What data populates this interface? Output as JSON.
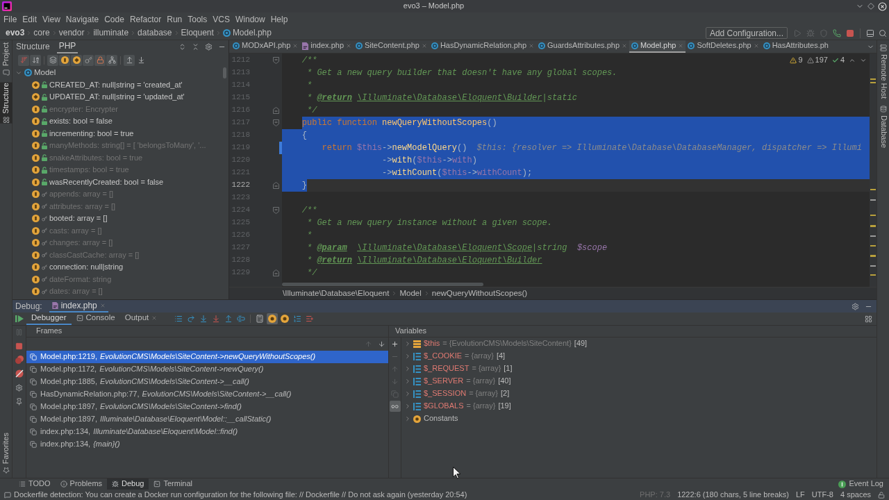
{
  "window": {
    "title": "evo3 – Model.php"
  },
  "menu": [
    "File",
    "Edit",
    "View",
    "Navigate",
    "Code",
    "Refactor",
    "Run",
    "Tools",
    "VCS",
    "Window",
    "Help"
  ],
  "breadcrumbs": [
    {
      "label": "evo3",
      "kind": "project"
    },
    {
      "label": "core",
      "kind": "folder"
    },
    {
      "label": "vendor",
      "kind": "folder"
    },
    {
      "label": "illuminate",
      "kind": "folder"
    },
    {
      "label": "database",
      "kind": "folder"
    },
    {
      "label": "Eloquent",
      "kind": "folder"
    },
    {
      "label": "Model.php",
      "kind": "file"
    }
  ],
  "run_toolbar": {
    "configuration": "Add Configuration...",
    "buttons": [
      {
        "kind": "run",
        "disabled": true
      },
      {
        "kind": "debug",
        "disabled": true
      },
      {
        "kind": "coverage",
        "disabled": true
      },
      {
        "kind": "listen",
        "disabled": false
      },
      {
        "kind": "stop",
        "disabled": false
      }
    ]
  },
  "left_strip": {
    "top": [
      {
        "label": "Project",
        "kind": "project",
        "selected": false
      },
      {
        "label": "Structure",
        "kind": "structure",
        "selected": true
      }
    ],
    "bottom": [
      {
        "label": "Favorites",
        "kind": "favorites",
        "selected": false
      }
    ]
  },
  "right_strip": [
    {
      "label": "Remote Host",
      "kind": "remote"
    },
    {
      "label": "Database",
      "kind": "database"
    }
  ],
  "structure": {
    "title": "Structure",
    "tabs": [
      {
        "label": "PHP",
        "selected": true
      }
    ],
    "toolbar": [
      {
        "kind": "sort_visibility",
        "on": true
      },
      {
        "kind": "sort_alpha",
        "on": true
      },
      {
        "kind": "inherited",
        "on": true
      },
      {
        "kind": "fields",
        "on": true
      },
      {
        "kind": "constants",
        "on": true
      },
      {
        "kind": "protected",
        "on": true
      },
      {
        "kind": "private",
        "on": true
      },
      {
        "kind": "tree",
        "on": true
      },
      {
        "kind": "scroll_to_source",
        "on": true
      },
      {
        "kind": "scroll_from_source",
        "on": false
      }
    ],
    "tree": {
      "label": "Model",
      "expanded": true,
      "children": [
        {
          "label": "CREATED_AT: null|string = 'created_at'",
          "kind": "constant",
          "protected": false,
          "greyed": false
        },
        {
          "label": "UPDATED_AT: null|string = 'updated_at'",
          "kind": "constant",
          "protected": false,
          "greyed": false
        },
        {
          "label": "encrypter: Encrypter",
          "kind": "field",
          "protected": false,
          "greyed": true
        },
        {
          "label": "exists: bool = false",
          "kind": "field",
          "protected": false,
          "greyed": false
        },
        {
          "label": "incrementing: bool = true",
          "kind": "field",
          "protected": false,
          "greyed": false
        },
        {
          "label": "manyMethods: string[] = [ 'belongsToMany', '...",
          "kind": "field",
          "protected": false,
          "greyed": true
        },
        {
          "label": "snakeAttributes: bool = true",
          "kind": "field",
          "protected": false,
          "greyed": true
        },
        {
          "label": "timestamps: bool = true",
          "kind": "field",
          "protected": false,
          "greyed": true
        },
        {
          "label": "wasRecentlyCreated: bool = false",
          "kind": "field",
          "protected": false,
          "greyed": false
        },
        {
          "label": "appends: array = []",
          "kind": "field",
          "protected": true,
          "greyed": true
        },
        {
          "label": "attributes: array = []",
          "kind": "field",
          "protected": true,
          "greyed": true
        },
        {
          "label": "booted: array = []",
          "kind": "field",
          "protected": true,
          "greyed": false
        },
        {
          "label": "casts: array = []",
          "kind": "field",
          "protected": true,
          "greyed": true
        },
        {
          "label": "changes: array = []",
          "kind": "field",
          "protected": true,
          "greyed": true
        },
        {
          "label": "classCastCache: array = []",
          "kind": "field",
          "protected": true,
          "greyed": true
        },
        {
          "label": "connection: null|string",
          "kind": "field",
          "protected": true,
          "greyed": false
        },
        {
          "label": "dateFormat: string",
          "kind": "field",
          "protected": true,
          "greyed": true
        },
        {
          "label": "dates: array = []",
          "kind": "field",
          "protected": true,
          "greyed": true
        }
      ]
    }
  },
  "editor": {
    "tabs": [
      {
        "label": "MODxAPI.php",
        "kind": "class",
        "selected": false,
        "close_button": true
      },
      {
        "label": "index.php",
        "kind": "script",
        "selected": false,
        "close_button": true
      },
      {
        "label": "SiteContent.php",
        "kind": "class",
        "selected": false,
        "close_button": true
      },
      {
        "label": "HasDynamicRelation.php",
        "kind": "class",
        "selected": false,
        "close_button": true
      },
      {
        "label": "GuardsAttributes.php",
        "kind": "class",
        "selected": false,
        "close_button": true
      },
      {
        "label": "Model.php",
        "kind": "class",
        "selected": true,
        "close_button": true
      },
      {
        "label": "SoftDeletes.php",
        "kind": "class",
        "selected": false,
        "close_button": true
      },
      {
        "label": "HasAttributes.ph",
        "kind": "class",
        "selected": false,
        "close_button": false
      }
    ],
    "inspections": {
      "warnings": "9",
      "weak_warnings": "197",
      "passed": "4"
    },
    "lines": [
      {
        "number": "1212",
        "fold": {
          "kind": "start"
        },
        "current": false,
        "tokens": [
          {
            "kind": "comment",
            "text": "    /**"
          }
        ]
      },
      {
        "number": "1213",
        "current": false,
        "tokens": [
          {
            "kind": "comment",
            "text": "     * Get a new query builder that doesn't have any global scopes."
          }
        ]
      },
      {
        "number": "1214",
        "current": false,
        "tokens": [
          {
            "kind": "comment",
            "text": "     *"
          }
        ]
      },
      {
        "number": "1215",
        "current": false,
        "tokens": [
          {
            "kind": "comment",
            "text": "     * "
          },
          {
            "kind": "doc_tag",
            "text": "@return"
          },
          {
            "kind": "doc_type",
            "text": " \\Illuminate\\Database\\Eloquent\\Builder"
          },
          {
            "kind": "comment",
            "text": "|static"
          }
        ]
      },
      {
        "number": "1216",
        "fold": {
          "kind": "end"
        },
        "current": false,
        "tokens": [
          {
            "kind": "comment",
            "text": "     */"
          }
        ]
      },
      {
        "number": "1217",
        "fold": {
          "kind": "start"
        },
        "selection": {
          "kind": "rest_of_line"
        },
        "current": false,
        "tokens": [
          {
            "kind": "keyword",
            "text": "    public function "
          },
          {
            "kind": "function",
            "text": "newQueryWithoutScopes"
          },
          {
            "kind": "plain",
            "text": "()"
          }
        ]
      },
      {
        "number": "1218",
        "selection": {
          "kind": "full"
        },
        "current": false,
        "tokens": [
          {
            "kind": "plain",
            "text": "    {"
          }
        ]
      },
      {
        "number": "1219",
        "selection": {
          "kind": "full"
        },
        "marker": {
          "kind": "execution_point"
        },
        "current": false,
        "tokens": [
          {
            "kind": "keyword",
            "text": "        return "
          },
          {
            "kind": "variable",
            "text": "$this"
          },
          {
            "kind": "plain",
            "text": "->"
          },
          {
            "kind": "call",
            "text": "newModelQuery"
          },
          {
            "kind": "plain",
            "text": "()"
          },
          {
            "kind": "hint",
            "text": "$this: {resolver => Illuminate\\Database\\DatabaseManager, dispatcher => Illumi"
          }
        ]
      },
      {
        "number": "1220",
        "selection": {
          "kind": "full"
        },
        "current": false,
        "tokens": [
          {
            "kind": "plain",
            "text": "                    ->"
          },
          {
            "kind": "call",
            "text": "with"
          },
          {
            "kind": "plain",
            "text": "("
          },
          {
            "kind": "variable",
            "text": "$this"
          },
          {
            "kind": "plain",
            "text": "->"
          },
          {
            "kind": "field",
            "text": "with"
          },
          {
            "kind": "plain",
            "text": ")"
          }
        ]
      },
      {
        "number": "1221",
        "selection": {
          "kind": "full"
        },
        "current": false,
        "tokens": [
          {
            "kind": "plain",
            "text": "                    ->"
          },
          {
            "kind": "call",
            "text": "withCount"
          },
          {
            "kind": "plain",
            "text": "("
          },
          {
            "kind": "variable",
            "text": "$this"
          },
          {
            "kind": "plain",
            "text": "->"
          },
          {
            "kind": "field",
            "text": "withCount"
          },
          {
            "kind": "plain",
            "text": ");"
          }
        ]
      },
      {
        "number": "1222",
        "fold": {
          "kind": "end"
        },
        "selection": {
          "kind": "to_code_end"
        },
        "current": true,
        "tokens": [
          {
            "kind": "plain",
            "text": "    }"
          }
        ]
      },
      {
        "number": "1223",
        "current": false
      },
      {
        "number": "1224",
        "fold": {
          "kind": "start"
        },
        "current": false,
        "tokens": [
          {
            "kind": "comment",
            "text": "    /**"
          }
        ]
      },
      {
        "number": "1225",
        "current": false,
        "tokens": [
          {
            "kind": "comment",
            "text": "     * Get a new query instance without a given scope."
          }
        ]
      },
      {
        "number": "1226",
        "current": false,
        "tokens": [
          {
            "kind": "comment",
            "text": "     *"
          }
        ]
      },
      {
        "number": "1227",
        "current": false,
        "tokens": [
          {
            "kind": "comment",
            "text": "     * "
          },
          {
            "kind": "doc_tag",
            "text": "@param"
          },
          {
            "kind": "doc_type",
            "text": "  \\Illuminate\\Database\\Eloquent\\Scope"
          },
          {
            "kind": "comment",
            "text": "|string  "
          },
          {
            "kind": "param",
            "text": "$scope"
          }
        ]
      },
      {
        "number": "1228",
        "current": false,
        "tokens": [
          {
            "kind": "comment",
            "text": "     * "
          },
          {
            "kind": "doc_tag",
            "text": "@return"
          },
          {
            "kind": "doc_type",
            "text": " \\Illuminate\\Database\\Eloquent\\Builder"
          }
        ]
      },
      {
        "number": "1229",
        "fold": {
          "kind": "end"
        },
        "current": false,
        "tokens": [
          {
            "kind": "comment",
            "text": "     */"
          }
        ]
      }
    ],
    "breadcrumb": [
      "\\Illuminate\\Database\\Eloquent",
      "Model",
      "newQueryWithoutScopes()"
    ]
  },
  "debug": {
    "title": "Debug:",
    "sessions": [
      {
        "label": "index.php",
        "selected": true
      }
    ],
    "resume": {
      "disabled": false
    },
    "tabs": [
      {
        "label": "Debugger",
        "kind": "debugger",
        "selected": true
      },
      {
        "label": "Console",
        "kind": "console",
        "selected": false
      },
      {
        "label": "Output",
        "kind": "output",
        "selected": false
      }
    ],
    "toolbar": [
      {
        "kind": "show_execution_point",
        "on": false
      },
      {
        "kind": "step_over",
        "on": false
      },
      {
        "kind": "step_into",
        "on": false
      },
      {
        "kind": "force_step_into",
        "on": false
      },
      {
        "kind": "step_out",
        "on": false
      },
      {
        "kind": "run_to_cursor",
        "on": false
      },
      {
        "kind": "evaluate",
        "on": false
      },
      {
        "kind": "break_first_line",
        "on": true
      },
      {
        "kind": "break_option",
        "on": false
      },
      {
        "kind": "frames_list",
        "on": false
      },
      {
        "kind": "add_watch",
        "on": false
      }
    ],
    "side_toolbar": [
      {
        "kind": "pause",
        "disabled": true
      },
      {
        "kind": "stop",
        "disabled": false
      },
      {
        "kind": "view_breakpoints",
        "disabled": false
      },
      {
        "kind": "mute_breakpoints",
        "disabled": false
      },
      {
        "kind": "settings",
        "disabled": false
      },
      {
        "kind": "pin",
        "disabled": false
      }
    ],
    "frames": {
      "header": "Frames",
      "navigation": [
        {
          "kind": "previous",
          "disabled": true
        },
        {
          "kind": "next",
          "disabled": false
        }
      ],
      "items": [
        {
          "location": "Model.php:1219,",
          "method": "EvolutionCMS\\Models\\SiteContent->newQueryWithoutScopes()",
          "selected": true
        },
        {
          "location": "Model.php:1172,",
          "method": "EvolutionCMS\\Models\\SiteContent->newQuery()",
          "selected": false
        },
        {
          "location": "Model.php:1885,",
          "method": "EvolutionCMS\\Models\\SiteContent->__call()",
          "selected": false
        },
        {
          "location": "HasDynamicRelation.php:77,",
          "method": "EvolutionCMS\\Models\\SiteContent->__call()",
          "selected": false
        },
        {
          "location": "Model.php:1897,",
          "method": "EvolutionCMS\\Models\\SiteContent->find()",
          "selected": false
        },
        {
          "location": "Model.php:1897,",
          "method": "Illuminate\\Database\\Eloquent\\Model::__callStatic()",
          "selected": false
        },
        {
          "location": "index.php:134,",
          "method": "Illuminate\\Database\\Eloquent\\Model::find()",
          "selected": false
        },
        {
          "location": "index.php:134,",
          "method": "{main}()",
          "selected": false
        }
      ]
    },
    "variables": {
      "header": "Variables",
      "toolbar": [
        {
          "kind": "add",
          "disabled": false,
          "on": false
        },
        {
          "kind": "remove",
          "disabled": true,
          "on": false
        },
        {
          "kind": "move_up",
          "disabled": true,
          "on": false
        },
        {
          "kind": "move_down",
          "disabled": true,
          "on": false
        },
        {
          "kind": "copy",
          "disabled": true,
          "on": false
        },
        {
          "kind": "inline_values",
          "disabled": false,
          "on": true
        }
      ],
      "items": [
        {
          "name": "$this",
          "value": "= {EvolutionCMS\\Models\\SiteContent}",
          "count": "[49]",
          "kind": "object",
          "expanded": false
        },
        {
          "name": "$_COOKIE",
          "value": "= {array}",
          "count": "[4]",
          "kind": "array",
          "expanded": false
        },
        {
          "name": "$_REQUEST",
          "value": "= {array}",
          "count": "[1]",
          "kind": "array",
          "expanded": false
        },
        {
          "name": "$_SERVER",
          "value": "= {array}",
          "count": "[40]",
          "kind": "array",
          "expanded": false
        },
        {
          "name": "$_SESSION",
          "value": "= {array}",
          "count": "[2]",
          "kind": "array",
          "expanded": false
        },
        {
          "name": "$GLOBALS",
          "value": "= {array}",
          "count": "[19]",
          "kind": "array",
          "expanded": false
        },
        {
          "name": "Constants",
          "kind": "constants",
          "expanded": false
        }
      ]
    }
  },
  "tool_tabs": [
    {
      "label": "TODO",
      "kind": "todo",
      "selected": false
    },
    {
      "label": "Problems",
      "kind": "problems",
      "selected": false
    },
    {
      "label": "Debug",
      "kind": "debug",
      "selected": true
    },
    {
      "label": "Terminal",
      "kind": "terminal",
      "selected": false
    }
  ],
  "event_log": {
    "label": "Event Log"
  },
  "status_bar": {
    "message": "Dockerfile detection: You can create a Docker run configuration for the following file: // Dockerfile // Do not ask again (yesterday 20:54)",
    "items": [
      {
        "label": "PHP: 7.3",
        "disabled": true
      },
      {
        "label": "1222:6 (180 chars, 5 line breaks)",
        "disabled": false
      },
      {
        "label": "LF",
        "disabled": false
      },
      {
        "label": "UTF-8",
        "disabled": false
      },
      {
        "label": "4 spaces",
        "disabled": false
      }
    ]
  }
}
